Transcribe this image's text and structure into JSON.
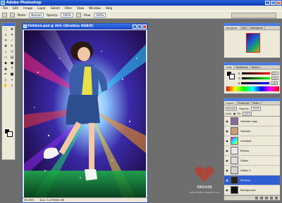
{
  "app": {
    "title": "Adobe Photoshop"
  },
  "menu": [
    "File",
    "Edit",
    "Image",
    "Layer",
    "Select",
    "Filter",
    "View",
    "Window",
    "Help"
  ],
  "options_bar": {
    "mode_label": "Mode:",
    "mode_value": "Normal",
    "opacity_label": "Opacity:",
    "opacity_value": "100%",
    "flow_label": "Flow:",
    "flow_value": "100%"
  },
  "document": {
    "title": "Children.psd @ 36% (Struktur, RGB/8)",
    "zoom": "36.36%",
    "doc_size": "Doc: 3.47M/60.9M"
  },
  "panels": {
    "navigator": {
      "tabs": [
        "Navigator",
        "Info",
        "Histogram"
      ]
    },
    "color": {
      "tabs": [
        "Color",
        "Swatches",
        "Styles"
      ],
      "channels": [
        {
          "label": "R",
          "value": "255"
        },
        {
          "label": "G",
          "value": "255"
        },
        {
          "label": "B",
          "value": "255"
        }
      ]
    },
    "layers": {
      "tabs": [
        "Layers",
        "Channels",
        "Paths"
      ],
      "blend_mode": "Normal",
      "opacity_label": "Opacity:",
      "opacity_value": "100%",
      "lock_label": "Lock:",
      "fill_label": "Fill:",
      "fill_value": "100%",
      "items": [
        {
          "name": "Gambar copy",
          "selected": false
        },
        {
          "name": "Gambar",
          "selected": false
        },
        {
          "name": "Gradient",
          "selected": false
        },
        {
          "name": "Effects",
          "selected": false
        },
        {
          "name": "Glitter",
          "selected": false
        },
        {
          "name": "Glitter 2",
          "selected": false
        },
        {
          "name": "Struktur",
          "selected": true
        },
        {
          "name": "Background",
          "selected": false
        }
      ]
    }
  },
  "watermark": {
    "label": "DESAIN",
    "sub": "www.desain.blogspot.com"
  },
  "colors": {
    "selected_layer": "#2f5fd0",
    "workspace": "#6e6e6e",
    "titlebar": "#0a3cb8"
  }
}
